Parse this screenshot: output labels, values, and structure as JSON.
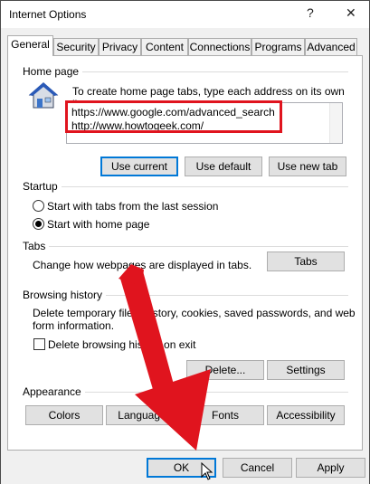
{
  "window": {
    "title": "Internet Options",
    "help_glyph": "?",
    "close_glyph": "✕"
  },
  "tabs": [
    {
      "label": "General",
      "active": true
    },
    {
      "label": "Security"
    },
    {
      "label": "Privacy"
    },
    {
      "label": "Content"
    },
    {
      "label": "Connections"
    },
    {
      "label": "Programs"
    },
    {
      "label": "Advanced"
    }
  ],
  "home_page": {
    "group_label": "Home page",
    "instruction": "To create home page tabs, type each address on its own line.",
    "addresses": [
      "https://www.google.com/advanced_search",
      "http://www.howtogeek.com/"
    ],
    "buttons": {
      "use_current": "Use current",
      "use_default": "Use default",
      "use_new_tab": "Use new tab"
    }
  },
  "startup": {
    "group_label": "Startup",
    "option_last_session": "Start with tabs from the last session",
    "option_home_page": "Start with home page",
    "selected": "home_page"
  },
  "tabs_section": {
    "group_label": "Tabs",
    "description": "Change how webpages are displayed in tabs.",
    "button": "Tabs"
  },
  "browsing_history": {
    "group_label": "Browsing history",
    "description_line1": "Delete temporary files, history, cookies, saved passwords, and web",
    "description_line2": "form information.",
    "checkbox_label": "Delete browsing history on exit",
    "checkbox_checked": false,
    "delete_button": "Delete...",
    "settings_button": "Settings"
  },
  "appearance": {
    "group_label": "Appearance",
    "colors_button": "Colors",
    "languages_button": "Languages",
    "fonts_button": "Fonts",
    "accessibility_button": "Accessibility"
  },
  "footer": {
    "ok": "OK",
    "cancel": "Cancel",
    "apply": "Apply"
  },
  "colors": {
    "highlight": "#e0141e",
    "focus": "#0078d7"
  },
  "icons": {
    "home": "house-icon",
    "arrow": "red-arrow-annotation",
    "cursor": "mouse-pointer-icon"
  }
}
